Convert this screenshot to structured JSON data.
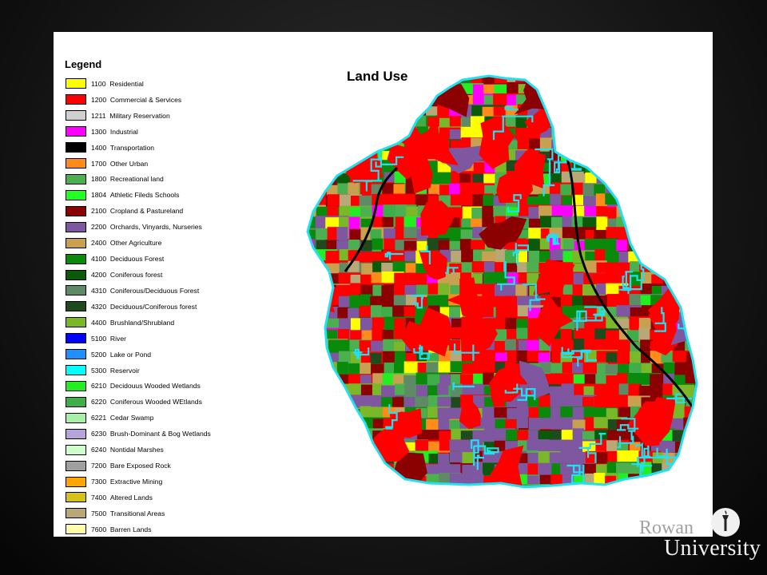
{
  "legend": {
    "title": "Legend",
    "items": [
      {
        "code": "1100",
        "label": "Residential",
        "color": "#ffff00"
      },
      {
        "code": "1200",
        "label": "Commercial & Services",
        "color": "#ff0000"
      },
      {
        "code": "1211",
        "label": "Military Reservation",
        "color": "#d0d0d0"
      },
      {
        "code": "1300",
        "label": "Industrial",
        "color": "#ff00ff"
      },
      {
        "code": "1400",
        "label": "Transportation",
        "color": "#000000"
      },
      {
        "code": "1700",
        "label": "Other Urban",
        "color": "#ff8c1a"
      },
      {
        "code": "1800",
        "label": "Recreational land",
        "color": "#4caf50"
      },
      {
        "code": "1804",
        "label": "Athletic Fileds Schools",
        "color": "#22ff22"
      },
      {
        "code": "2100",
        "label": "Cropland & Pastureland",
        "color": "#8b0000"
      },
      {
        "code": "2200",
        "label": "Orchards, Vinyards, Nurseries",
        "color": "#7e57a0"
      },
      {
        "code": "2400",
        "label": "Other Agriculture",
        "color": "#c8a050"
      },
      {
        "code": "4100",
        "label": "Deciduous Forest",
        "color": "#0a8a0a"
      },
      {
        "code": "4200",
        "label": "Coniferous forest",
        "color": "#0a5a0a"
      },
      {
        "code": "4310",
        "label": "Coniferous/Deciduous Forest",
        "color": "#5e8a66"
      },
      {
        "code": "4320",
        "label": "Deciduous/Coniferous forest",
        "color": "#1e4a1e"
      },
      {
        "code": "4400",
        "label": "Brushland/Shrubland",
        "color": "#7ab82a"
      },
      {
        "code": "5100",
        "label": "River",
        "color": "#0000ff"
      },
      {
        "code": "5200",
        "label": "Lake or Pond",
        "color": "#1e90ff"
      },
      {
        "code": "5300",
        "label": "Reservoir",
        "color": "#00ffff"
      },
      {
        "code": "6210",
        "label": "Decidouus Wooded Wetlands",
        "color": "#22ee22"
      },
      {
        "code": "6220",
        "label": "Coniferous Wooded WEtlands",
        "color": "#3fae4a"
      },
      {
        "code": "6221",
        "label": "Cedar Swamp",
        "color": "#a8f0a8"
      },
      {
        "code": "6230",
        "label": "Brush-Dominant & Bog Wetlands",
        "color": "#b4a4d8"
      },
      {
        "code": "6240",
        "label": "Nontidal Marshes",
        "color": "#ccffcc"
      },
      {
        "code": "7200",
        "label": "Bare Exposed Rock",
        "color": "#a0a0a0"
      },
      {
        "code": "7300",
        "label": "Extractive Mining",
        "color": "#ffa500"
      },
      {
        "code": "7400",
        "label": "Altered Lands",
        "color": "#d4c21a"
      },
      {
        "code": "7500",
        "label": "Transitional Areas",
        "color": "#b8a878"
      },
      {
        "code": "7600",
        "label": "Barren Lands",
        "color": "#ffffaa"
      }
    ]
  },
  "map": {
    "title": "Land Use",
    "boundary_color": "#22e0f0",
    "road_color": "#000000"
  },
  "logo": {
    "university": "University",
    "name": "Rowan"
  }
}
